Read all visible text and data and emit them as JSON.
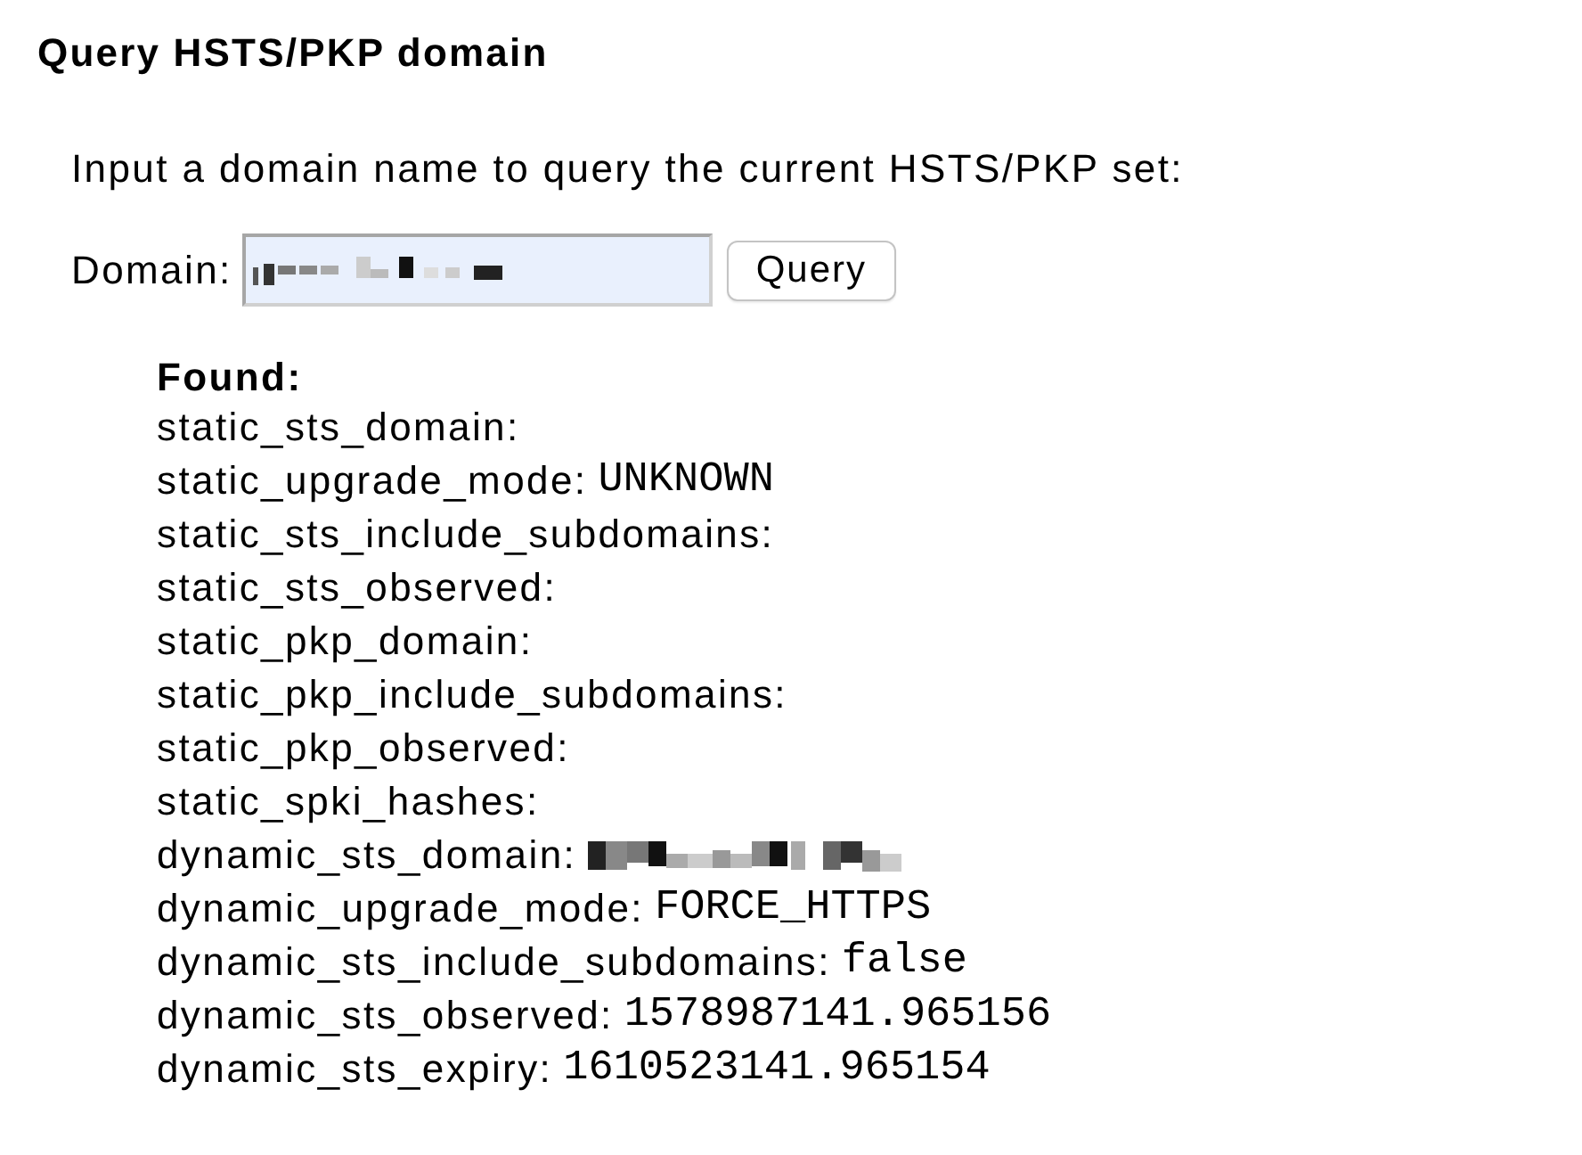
{
  "title": "Query HSTS/PKP domain",
  "instructions": "Input a domain name to query the current HSTS/PKP set:",
  "domain_field": {
    "label": "Domain:",
    "value_redacted": true
  },
  "query_button": {
    "label": "Query"
  },
  "result": {
    "heading": "Found:",
    "fields": [
      {
        "key": "static_sts_domain:"
      },
      {
        "key": "static_upgrade_mode:",
        "value": "UNKNOWN"
      },
      {
        "key": "static_sts_include_subdomains:"
      },
      {
        "key": "static_sts_observed:"
      },
      {
        "key": "static_pkp_domain:"
      },
      {
        "key": "static_pkp_include_subdomains:"
      },
      {
        "key": "static_pkp_observed:"
      },
      {
        "key": "static_spki_hashes:"
      },
      {
        "key": "dynamic_sts_domain:",
        "value_redacted": true
      },
      {
        "key": "dynamic_upgrade_mode:",
        "value": "FORCE_HTTPS"
      },
      {
        "key": "dynamic_sts_include_subdomains:",
        "value": "false"
      },
      {
        "key": "dynamic_sts_observed:",
        "value": "1578987141.965156"
      },
      {
        "key": "dynamic_sts_expiry:",
        "value": "1610523141.965154"
      }
    ]
  }
}
